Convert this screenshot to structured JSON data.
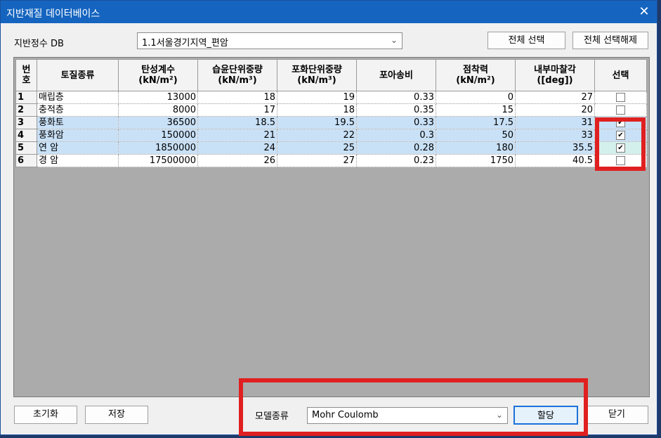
{
  "window": {
    "title": "지반재질 데이터베이스",
    "close_glyph": "✕"
  },
  "db": {
    "label": "지반정수 DB",
    "selected": "1.1서울경기지역_편암",
    "select_all": "전체 선택",
    "deselect_all": "전체 선택해제"
  },
  "table": {
    "headers": {
      "no": "번\n호",
      "type": "토질종류",
      "elastic": "탄성계수\n(kN/m²)",
      "wet": "습윤단위중량\n(kN/m³)",
      "sat": "포화단위중량\n(kN/m³)",
      "poisson": "포아송비",
      "cohesion": "점착력\n(kN/m²)",
      "friction": "내부마찰각\n([deg])",
      "select": "선택"
    },
    "rows": [
      {
        "no": "1",
        "type": "매립층",
        "elastic": "13000",
        "wet": "18",
        "sat": "19",
        "poisson": "0.33",
        "cohesion": "0",
        "friction": "27",
        "checked": false,
        "check_glyph": ""
      },
      {
        "no": "2",
        "type": "충적층",
        "elastic": "8000",
        "wet": "17",
        "sat": "18",
        "poisson": "0.35",
        "cohesion": "15",
        "friction": "20",
        "checked": false,
        "check_glyph": ""
      },
      {
        "no": "3",
        "type": "풍화토",
        "elastic": "36500",
        "wet": "18.5",
        "sat": "19.5",
        "poisson": "0.33",
        "cohesion": "17.5",
        "friction": "31",
        "checked": true,
        "check_glyph": "✔"
      },
      {
        "no": "4",
        "type": "풍화암",
        "elastic": "150000",
        "wet": "21",
        "sat": "22",
        "poisson": "0.3",
        "cohesion": "50",
        "friction": "33",
        "checked": true,
        "check_glyph": "✔"
      },
      {
        "no": "5",
        "type": "연 암",
        "elastic": "1850000",
        "wet": "24",
        "sat": "25",
        "poisson": "0.28",
        "cohesion": "180",
        "friction": "35.5",
        "checked": true,
        "check_glyph": "✔"
      },
      {
        "no": "6",
        "type": "경 암",
        "elastic": "17500000",
        "wet": "26",
        "sat": "27",
        "poisson": "0.23",
        "cohesion": "1750",
        "friction": "40.5",
        "checked": false,
        "check_glyph": ""
      }
    ]
  },
  "footer": {
    "reset": "초기화",
    "save": "저장",
    "model_label": "모델종류",
    "model_value": "Mohr Coulomb",
    "assign": "할당",
    "close": "닫기"
  },
  "colors": {
    "titlebar": "#1565c0",
    "highlight": "#e02020",
    "selected_row": "#c9e1f7"
  },
  "icons": {
    "dropdown": "chevron-down-icon",
    "close": "close-icon"
  }
}
